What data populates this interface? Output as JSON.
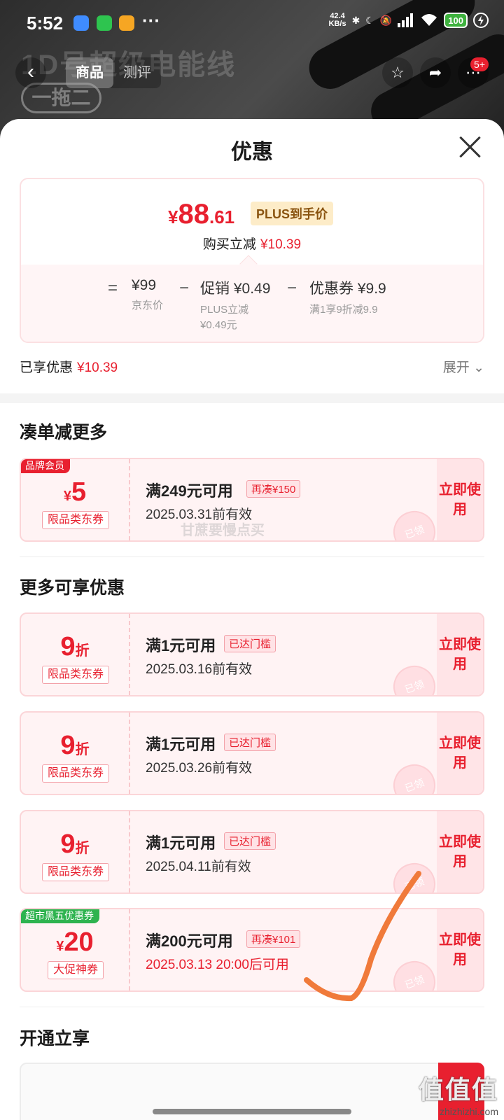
{
  "status_bar": {
    "time": "5:52",
    "more": "···",
    "speed_value": "42.4",
    "speed_unit": "KB/s",
    "battery": "100"
  },
  "hero": {
    "product_text": "1D号超级电能线",
    "pill_text": "一拖二"
  },
  "nav": {
    "tabs": [
      "商品",
      "测评"
    ],
    "notification_badge": "5+"
  },
  "sheet": {
    "title": "优惠",
    "price": {
      "yen": "¥",
      "integer": "88",
      "decimal": ".61"
    },
    "plus_tag": "PLUS到手价",
    "buy_reduce_label": "购买立减",
    "buy_reduce_value": "¥10.39",
    "breakdown": {
      "equals": "=",
      "minus": "−",
      "jd_price": "¥99",
      "jd_price_label": "京东价",
      "promo": "促销 ¥0.49",
      "promo_sub1": "PLUS立减",
      "promo_sub2": "¥0.49元",
      "coupon": "优惠券 ¥9.9",
      "coupon_sub": "满1享9折减9.9"
    },
    "enjoyed_label": "已享优惠",
    "enjoyed_value": "¥10.39",
    "expand": "展开"
  },
  "section_more": "凑单减更多",
  "section_enjoy": "更多可享优惠",
  "section_open": "开通立享",
  "coupons": [
    {
      "tag": "品牌会员",
      "prefix": "¥",
      "value": "5",
      "suffix": "",
      "type": "限品类东券",
      "title": "满249元可用",
      "chip": "再凑¥150",
      "date": "2025.03.31前有效",
      "use": "立即使用",
      "stamp": "已领"
    },
    {
      "tag": "",
      "prefix": "",
      "value": "9",
      "suffix": "折",
      "type": "限品类东券",
      "title": "满1元可用",
      "chip": "已达门槛",
      "date": "2025.03.16前有效",
      "use": "立即使用",
      "stamp": "已领"
    },
    {
      "tag": "",
      "prefix": "",
      "value": "9",
      "suffix": "折",
      "type": "限品类东券",
      "title": "满1元可用",
      "chip": "已达门槛",
      "date": "2025.03.26前有效",
      "use": "立即使用",
      "stamp": "已领"
    },
    {
      "tag": "",
      "prefix": "",
      "value": "9",
      "suffix": "折",
      "type": "限品类东券",
      "title": "满1元可用",
      "chip": "已达门槛",
      "date": "2025.04.11前有效",
      "use": "立即使用",
      "stamp": "已领"
    },
    {
      "tag": "超市黑五优惠券",
      "prefix": "¥",
      "value": "20",
      "suffix": "",
      "type": "大促神券",
      "title": "满200元可用",
      "chip": "再凑¥101",
      "date": "2025.03.13 20:00后可用",
      "use": "立即使用",
      "stamp": "已领"
    }
  ],
  "watermark": "甘蔗要慢点买",
  "site_mark": {
    "logo": "值值值",
    "url": "zhizhizhi.com"
  },
  "colors": {
    "accent": "#e8202f",
    "tag_red": "#e8202f",
    "tag_green": "#2eb34f",
    "annotation": "#f07a3a"
  }
}
